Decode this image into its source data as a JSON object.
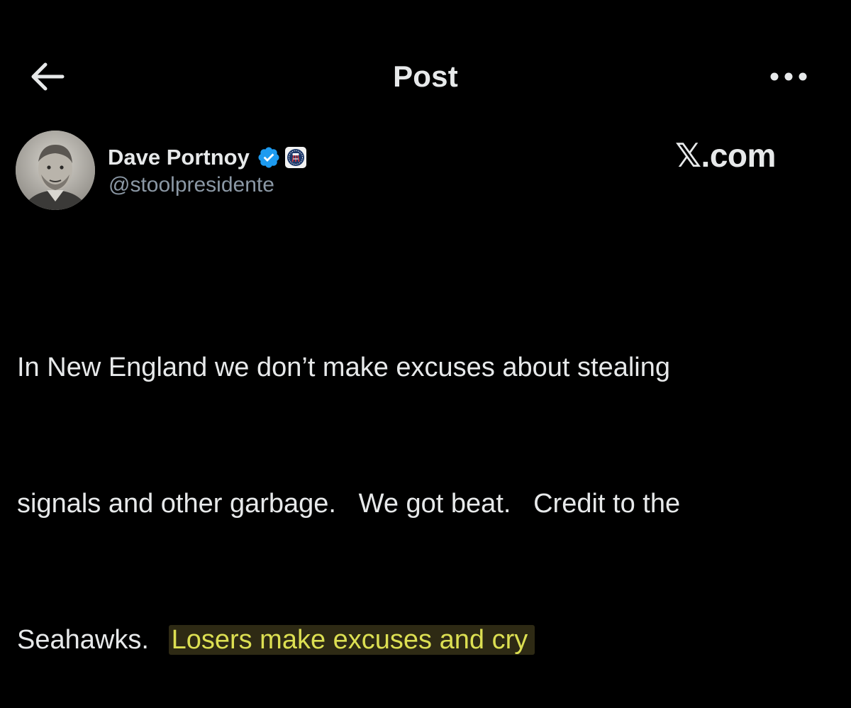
{
  "header": {
    "title": "Post",
    "back_icon": "arrow-left-icon",
    "more_icon": "more-horizontal-icon"
  },
  "author": {
    "name": "Dave Portnoy",
    "handle": "@stoolpresidente",
    "verified_icon": "verified-badge-icon",
    "affiliate_icon": "barstool-affiliate-icon"
  },
  "site_label": "𝕏.com",
  "post": {
    "lines": [
      "In New England we don’t make excuses about stealing",
      "signals and other garbage.   We got beat.   Credit to the",
      "Seahawks.   "
    ],
    "highlighted_text": "Losers make excuses and cry"
  },
  "colors": {
    "background": "#000000",
    "text": "#e7e9ea",
    "handle": "#8b98a5",
    "verified": "#1d9bf0",
    "highlight_text": "#dcdf52",
    "highlight_bg": "#2e2a14"
  }
}
